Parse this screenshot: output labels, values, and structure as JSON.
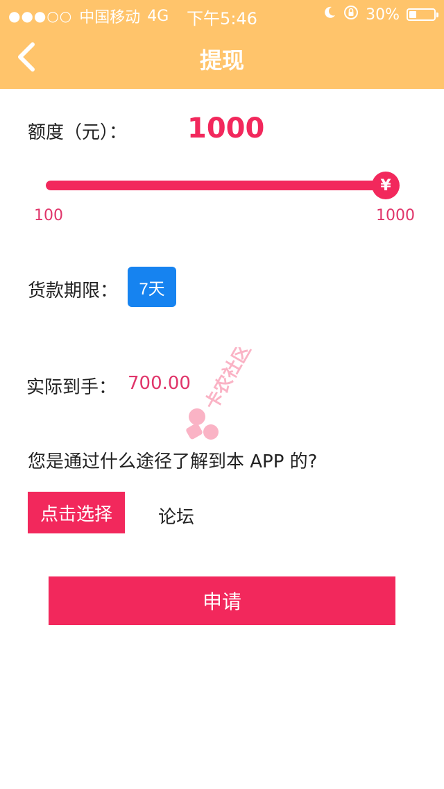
{
  "status_bar": {
    "signal": "●●●○○",
    "carrier": "中国移动",
    "network": "4G",
    "time": "下午5:46",
    "battery_text": "30%",
    "battery_level": 0.3,
    "icons": [
      "moon-icon",
      "rotation-lock-icon",
      "battery-icon"
    ]
  },
  "navbar": {
    "title": "提现",
    "back_icon": "chevron-left-icon"
  },
  "amount": {
    "label": "额度（元）：",
    "value": "1000",
    "min_label": "100",
    "max_label": "1000",
    "min": 100,
    "max": 1000,
    "current": 1000,
    "thumb_symbol": "¥"
  },
  "term": {
    "label": "货款期限：",
    "option": "7天"
  },
  "received": {
    "label": "实际到手：",
    "value": "700.00"
  },
  "source": {
    "question": "您是通过什么途径了解到本 APP 的?",
    "button_label": "点击选择",
    "selected_value": "论坛"
  },
  "submit": {
    "label": "申请"
  },
  "watermark": {
    "text": "卡农社区"
  },
  "colors": {
    "header": "#FFC46B",
    "accent": "#F2285C",
    "term_button": "#1683F0"
  }
}
